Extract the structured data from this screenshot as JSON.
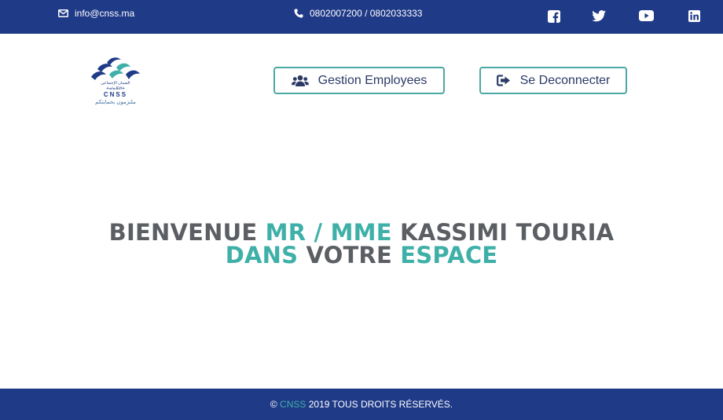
{
  "topbar": {
    "email": "info@cnss.ma",
    "phone": "0802007200 / 0802033333",
    "icons": [
      "envelope-icon",
      "phone-icon",
      "facebook-icon",
      "twitter-icon",
      "youtube-icon",
      "linkedin-icon"
    ]
  },
  "logo": {
    "arabic_top": "الضمان الإجتماعي",
    "tifinagh": "ⵜⴰⵏⴰⴼⵍⵜ",
    "name": "CNSS",
    "arabic_tagline": "ملتزمون بحمايتكم"
  },
  "nav": {
    "gestion_label": "Gestion Employees",
    "deconnecter_label": "Se Deconnecter"
  },
  "welcome": {
    "word1": "BIENVENUE",
    "word2": "MR / MME",
    "word3": "KASSIMI TOURIA",
    "word4": "DANS",
    "word5": "VOTRE",
    "word6": "ESPACE"
  },
  "footer": {
    "copyright_symbol": "©",
    "brand": "CNSS",
    "text": "2019 TOUS DROITS RÉSERVÉS."
  },
  "colors": {
    "navy": "#1f3a87",
    "teal": "#3fb0a8",
    "gray_text": "#5b5f63",
    "button_border": "#4aa9a4"
  }
}
